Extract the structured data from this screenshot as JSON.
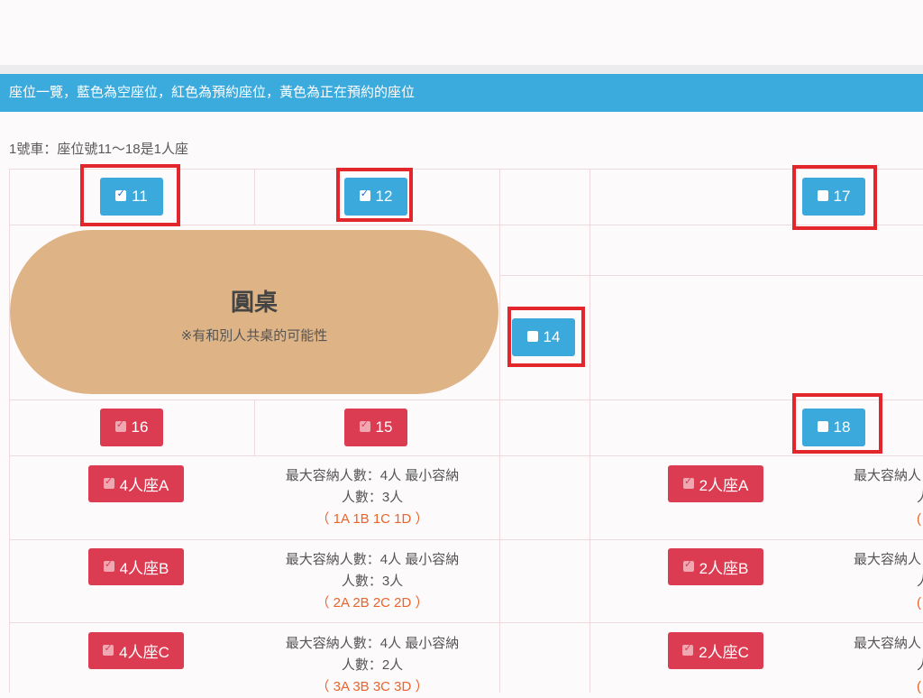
{
  "banner": "座位一覽，藍色為空座位，紅色為預約座位，黃色為正在預約的座位",
  "caption": "1號車：座位號11～18是1人座",
  "colors": {
    "empty_seat": "#3ba9db",
    "reserved_seat": "#dc3c52",
    "highlight": "#e3262b",
    "round_table": "#deb386",
    "banner": "#3baadc"
  },
  "seats": {
    "s11": {
      "label": "11",
      "status": "empty",
      "checked": true
    },
    "s12": {
      "label": "12",
      "status": "empty",
      "checked": true
    },
    "s17": {
      "label": "17",
      "status": "empty",
      "checked": false
    },
    "s14": {
      "label": "14",
      "status": "empty",
      "checked": false
    },
    "s16": {
      "label": "16",
      "status": "reserved",
      "checked": true
    },
    "s15": {
      "label": "15",
      "status": "reserved",
      "checked": true
    },
    "s18": {
      "label": "18",
      "status": "empty",
      "checked": false
    }
  },
  "round_table": {
    "title": "圓桌",
    "note": "※有和別人共桌的可能性"
  },
  "group_seats": [
    {
      "button": "4人座A",
      "info_line1": "最大容納人數：4人 最小容納",
      "info_line2": "人數：3人",
      "codes": "（ 1A  1B  1C  1D ）"
    },
    {
      "button": "4人座B",
      "info_line1": "最大容納人數：4人 最小容納",
      "info_line2": "人數：3人",
      "codes": "（ 2A  2B  2C  2D ）"
    },
    {
      "button": "4人座C",
      "info_line1": "最大容納人數：4人 最小容納",
      "info_line2": "人數：2人",
      "codes": "（ 3A  3B  3C  3D ）"
    }
  ],
  "pair_seats": [
    {
      "button": "2人座A",
      "info_line1": "最大容納人",
      "info_line2": "人",
      "codes": "("
    },
    {
      "button": "2人座B",
      "info_line1": "最大容納人",
      "info_line2": "人",
      "codes": "("
    },
    {
      "button": "2人座C",
      "info_line1": "最大容納人",
      "info_line2": "人",
      "codes": "("
    }
  ]
}
